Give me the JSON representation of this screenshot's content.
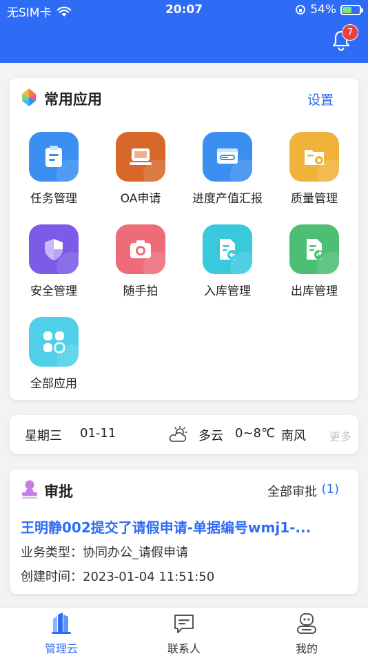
{
  "status_bar": {
    "carrier": "无SIM卡",
    "time": "20:07",
    "battery": "54%",
    "battery_level": 0.54
  },
  "header": {
    "notification_count": "7"
  },
  "common_apps": {
    "title": "常用应用",
    "settings_label": "设置",
    "items": [
      {
        "label": "任务管理",
        "icon": "clipboard-icon",
        "color": "#3a8ff0"
      },
      {
        "label": "OA申请",
        "icon": "laptop-icon",
        "color": "#d8682a"
      },
      {
        "label": "进度产值汇报",
        "icon": "progress-icon",
        "color": "#3a8ff0"
      },
      {
        "label": "质量管理",
        "icon": "folder-star-icon",
        "color": "#f0b23a"
      },
      {
        "label": "安全管理",
        "icon": "shield-icon",
        "color": "#7b5be8"
      },
      {
        "label": "随手拍",
        "icon": "camera-icon",
        "color": "#ee6b7a"
      },
      {
        "label": "入库管理",
        "icon": "doc-in-icon",
        "color": "#38c9dc"
      },
      {
        "label": "出库管理",
        "icon": "doc-out-icon",
        "color": "#4cbf74"
      },
      {
        "label": "全部应用",
        "icon": "all-apps-icon",
        "color": "#4fd0e8"
      }
    ]
  },
  "weather": {
    "weekday": "星期三",
    "date": "01-11",
    "condition": "多云",
    "temperature": "0~8℃",
    "wind": "南风",
    "more": "更多"
  },
  "approval": {
    "title": "审批",
    "all_label": "全部审批",
    "count": "(1)",
    "item_title": "王明静002提交了请假申请-单据编号wmj1-...",
    "type_line": "业务类型：协同办公_请假申请",
    "created_line": "创建时间：2023-01-04 11:51:50"
  },
  "tabbar": {
    "tabs": [
      {
        "label": "管理云",
        "active": true
      },
      {
        "label": "联系人",
        "active": false
      },
      {
        "label": "我的",
        "active": false
      }
    ]
  },
  "colors": {
    "primary": "#2f6cf5",
    "badge": "#e8413f"
  }
}
